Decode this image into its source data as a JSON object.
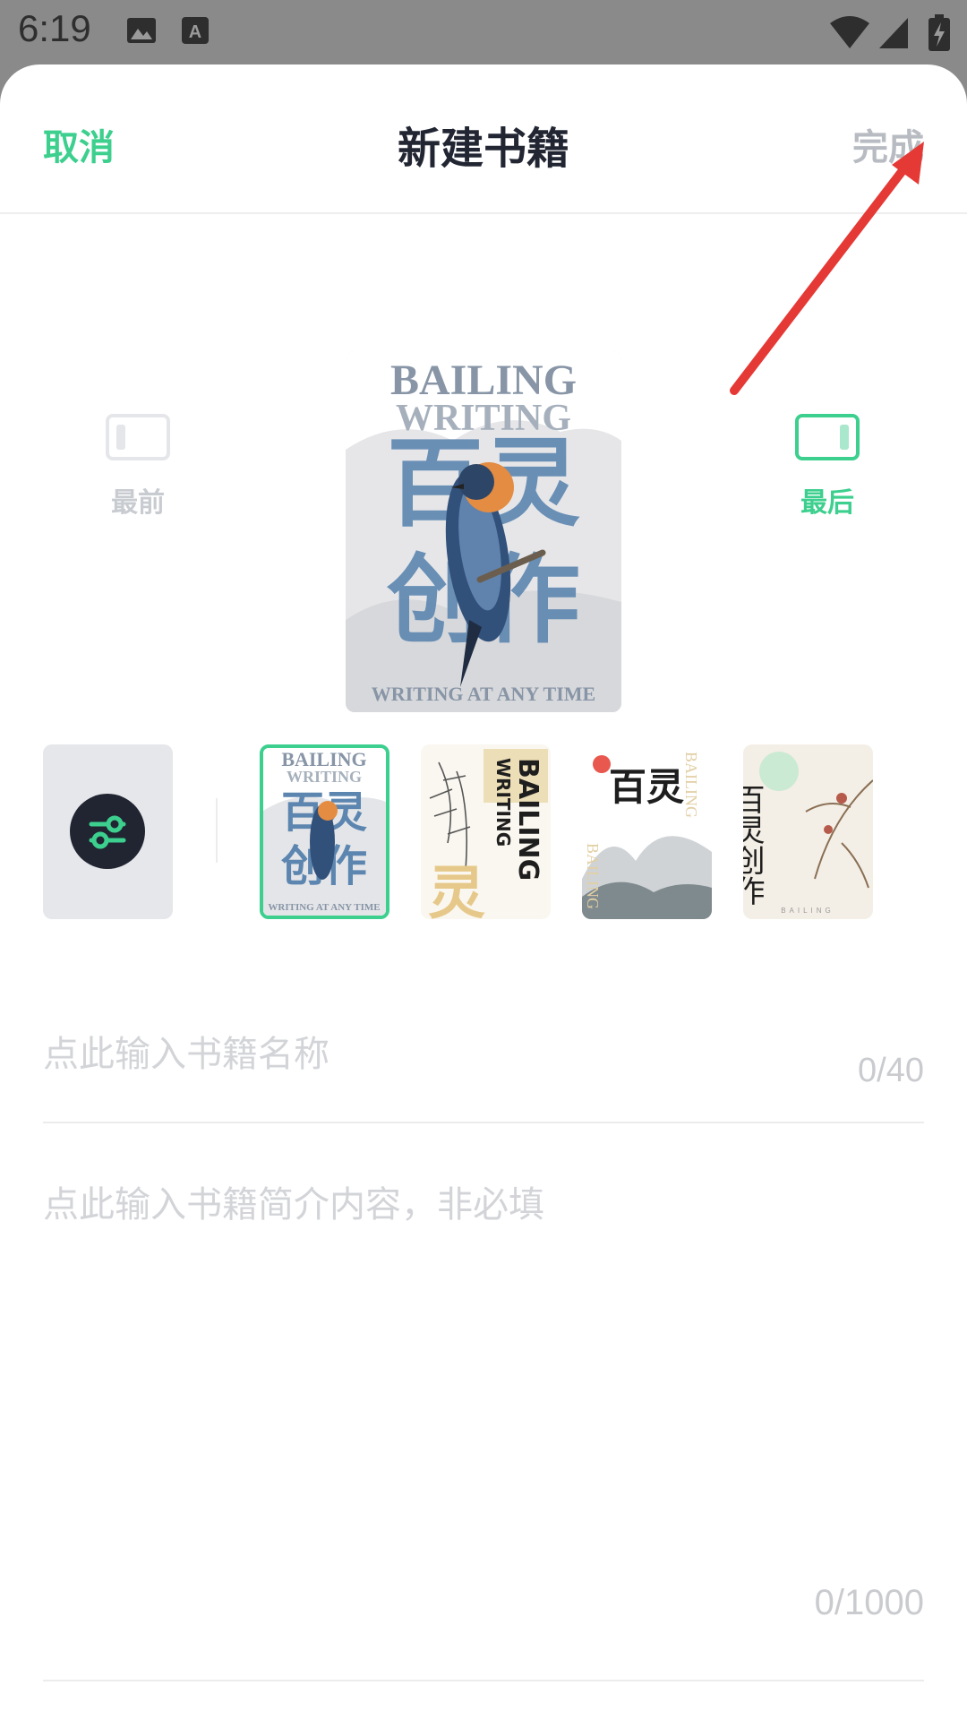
{
  "status_bar": {
    "time": "6:19"
  },
  "header": {
    "cancel": "取消",
    "title": "新建书籍",
    "done": "完成"
  },
  "order": {
    "first": "最前",
    "last": "最后"
  },
  "cover": {
    "title_line1": "BAILING",
    "title_line2": "WRITING",
    "chinese_line1": "百灵",
    "chinese_line2": "创作",
    "bottom_text": "WRITING AT ANY TIME"
  },
  "thumbnails": [
    {
      "top": "BAILING",
      "second": "WRITING",
      "cn": "百灵",
      "cn2": "创作",
      "bottom": "WRITING AT ANY TIME"
    },
    {
      "en": "BAILING",
      "en2": "WRITING",
      "cn": "灵"
    },
    {
      "cn": "百灵",
      "en": "BAILING"
    },
    {
      "cn": "百灵创作",
      "en": "BAILING"
    }
  ],
  "form": {
    "name_placeholder": "点此输入书籍名称",
    "name_counter": "0/40",
    "intro_placeholder": "点此输入书籍简介内容，非必填",
    "intro_counter": "0/1000"
  },
  "colors": {
    "accent": "#3ccf8e",
    "annotation_arrow": "#e53935"
  }
}
